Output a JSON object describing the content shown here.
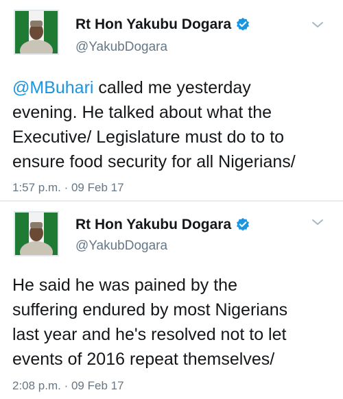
{
  "tweets": [
    {
      "name": "Rt Hon Yakubu Dogara",
      "handle": "@YakubDogara",
      "mention": "@MBuhari",
      "text_after_mention": " called me yesterday\nevening. He talked about what the\nExecutive/ Legislature must do to to\nensure food security for all Nigerians/",
      "time": "1:57 p.m. · 09 Feb 17"
    },
    {
      "name": "Rt Hon Yakubu Dogara",
      "handle": "@YakubDogara",
      "text": "He said he was pained by the\nsuffering endured by most Nigerians\nlast year and he's resolved not to let\nevents of 2016 repeat themselves/",
      "time": "2:08 p.m. · 09 Feb 17"
    }
  ],
  "colors": {
    "verified": "#1b95e0",
    "mention": "#1b95e0",
    "secondary_text": "#657786"
  },
  "icons": {
    "verified": "verified-badge-icon",
    "menu": "chevron-down-icon",
    "avatar": "profile-photo"
  }
}
